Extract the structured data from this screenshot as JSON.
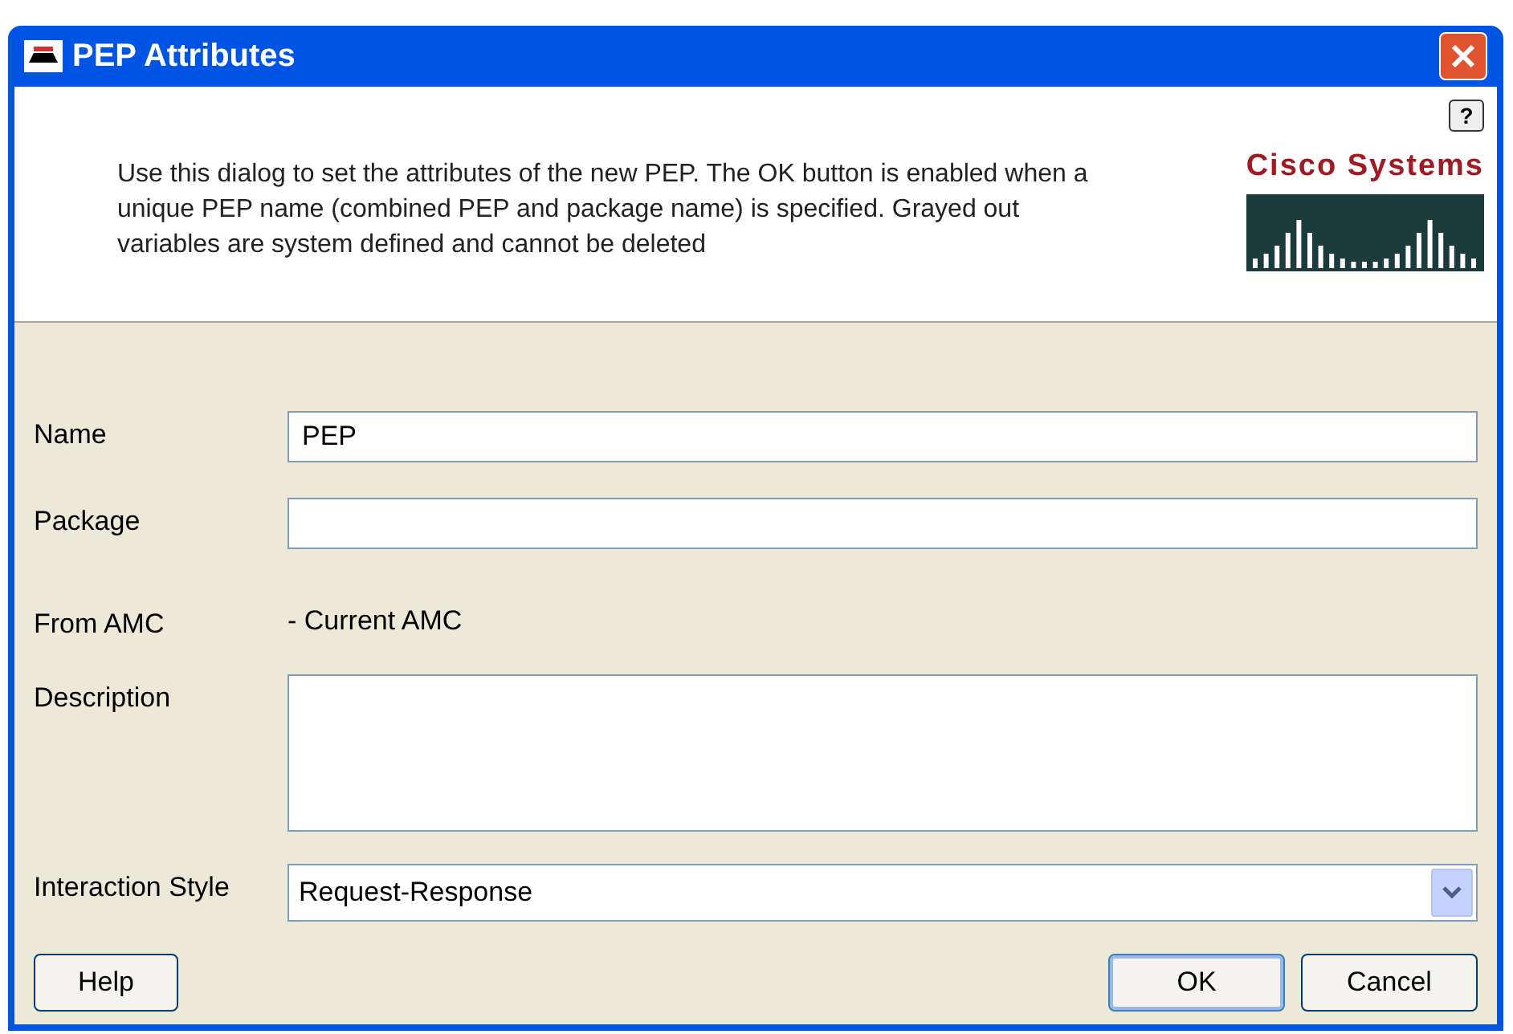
{
  "window": {
    "title": "PEP Attributes"
  },
  "header": {
    "help_button": "?",
    "description": "Use this dialog to set the attributes of the new PEP. The OK button is enabled when a unique PEP name (combined PEP and package name) is specified. Grayed out variables are system defined and cannot be deleted",
    "logo_text": "Cisco Systems"
  },
  "fields": [
    {
      "kind": "text",
      "label": "Name",
      "value": "PEP"
    },
    {
      "kind": "text",
      "label": "Package"
    },
    {
      "kind": "static",
      "label": "From AMC",
      "value": "- Current AMC"
    },
    {
      "kind": "textarea",
      "label": "Description"
    },
    {
      "kind": "select",
      "label": "Interaction Style",
      "value": "Request-Response"
    }
  ],
  "buttons": {
    "left": [
      "Help"
    ],
    "right": [
      {
        "label": "OK",
        "default": true
      },
      {
        "label": "Cancel",
        "default": false
      }
    ]
  }
}
